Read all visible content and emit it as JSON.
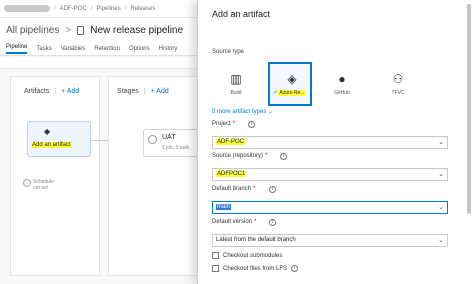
{
  "breadcrumb": {
    "project": "ADF-POC",
    "section": "Pipelines",
    "page": "Releases"
  },
  "header": {
    "all_pipelines": "All pipelines",
    "separator": ">",
    "pipeline_name": "New release pipeline"
  },
  "tabs": [
    "Pipeline",
    "Tasks",
    "Variables",
    "Retention",
    "Options",
    "History"
  ],
  "canvas": {
    "artifacts_title": "Artifacts",
    "artifacts_add": "Add",
    "add_artifact_label": "Add an artifact",
    "schedule_label": "Schedule",
    "schedule_sub": "not set",
    "stages_title": "Stages",
    "stages_add": "Add",
    "stage_name": "UAT",
    "stage_sub": "1 job, 0 task"
  },
  "panel": {
    "title": "Add an artifact",
    "source_type_label": "Source type",
    "source_types": [
      {
        "name": "Build",
        "icon": "build-icon"
      },
      {
        "name": "Azure Re...",
        "icon": "azure-repos-icon",
        "selected": true
      },
      {
        "name": "GitHub",
        "icon": "github-icon"
      },
      {
        "name": "TFVC",
        "icon": "tfvc-icon"
      }
    ],
    "more_types": "5 more artifact types",
    "project_label": "Project",
    "project_value": "ADF-POC",
    "repo_label": "Source (repository)",
    "repo_value": "ADFPOC1",
    "branch_label": "Default branch",
    "branch_value": "main",
    "version_label": "Default version",
    "version_value": "Latest from the default branch",
    "checkbox_submodules": "Checkout submodules",
    "checkbox_lfs": "Checkout files from LFS"
  },
  "colors": {
    "accent": "#0078d4",
    "highlight": "#ffff3a",
    "selection": "#3a78d0"
  }
}
